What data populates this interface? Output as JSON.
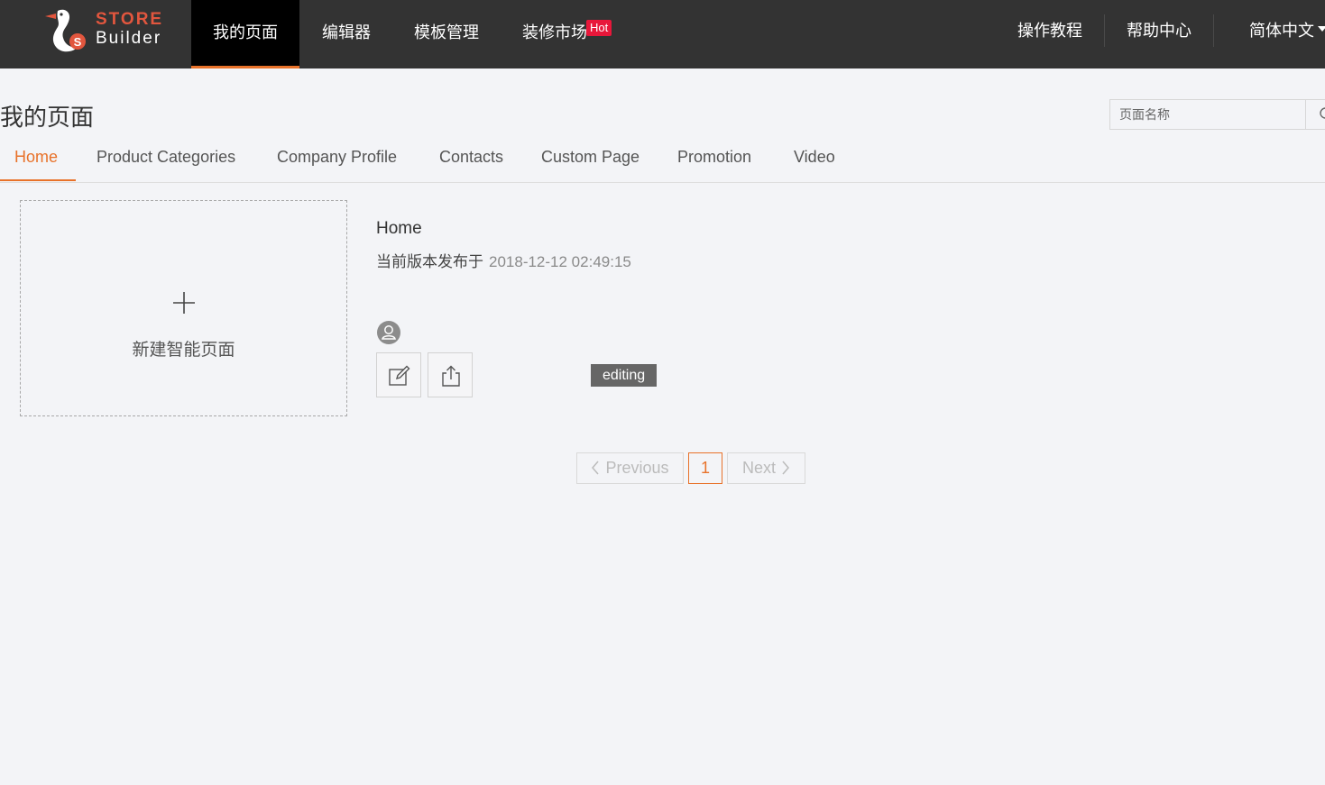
{
  "brand": {
    "line1": "STORE",
    "line2": "Builder",
    "accent_color": "#e2563e"
  },
  "nav": {
    "items": [
      {
        "label": "我的页面",
        "active": true
      },
      {
        "label": "编辑器"
      },
      {
        "label": "模板管理"
      },
      {
        "label": "装修市场",
        "badge": "Hot"
      }
    ],
    "right": {
      "tutorial": "操作教程",
      "help": "帮助中心",
      "language": "简体中文"
    }
  },
  "page": {
    "title": "我的页面",
    "search_placeholder": "页面名称"
  },
  "tabs": [
    {
      "label": "Home",
      "active": true
    },
    {
      "label": "Product Categories"
    },
    {
      "label": "Company Profile"
    },
    {
      "label": "Contacts"
    },
    {
      "label": "Custom Page"
    },
    {
      "label": "Promotion"
    },
    {
      "label": "Video"
    }
  ],
  "new_page_card": {
    "label": "新建智能页面"
  },
  "page_item": {
    "name": "Home",
    "published_label": "当前版本发布于",
    "published_time": "2018-12-12 02:49:15",
    "status": "editing"
  },
  "pagination": {
    "previous": "Previous",
    "current": "1",
    "next": "Next"
  },
  "colors": {
    "topbar": "#333333",
    "accent": "#e8722a",
    "hot": "#e8173a",
    "status_badge": "#666666"
  }
}
